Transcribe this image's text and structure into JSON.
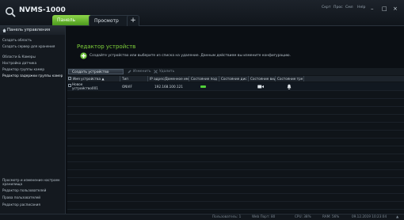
{
  "app": {
    "title": "NVMS-1000"
  },
  "tabs": [
    {
      "label": "Панель управл"
    },
    {
      "label": "Просмотр"
    },
    {
      "label": "+"
    }
  ],
  "top_menu": {
    "items": [
      "Скрт",
      "Прос",
      "Смл",
      "Help"
    ]
  },
  "window_controls": [
    "–",
    "□",
    "×"
  ],
  "sidebar": {
    "header": "Панель управления",
    "items": [
      "Создать область",
      "Создать сервер для хранения",
      "Области & Камеры",
      "Настройка датчика",
      "Редактор группы камер",
      "Редактор задержки группы камер"
    ],
    "bottom_items": [
      "Просмотр и изменение настроек хранилища",
      "Редактор пользователей",
      "Права пользователей",
      "Редактор расписания"
    ]
  },
  "main": {
    "title": "Редактор устройств",
    "info": "Создайте устройство или выберите из списка на удаление. Данным действием вы измените конфигурацию.",
    "toolbar": {
      "create": "Создать устройство",
      "edit": "Изменить",
      "delete": "Удалить"
    },
    "table": {
      "columns": [
        "Имя устройства",
        "Тип",
        "IP адрес/Доменное имя",
        "Состояние под",
        "Состояние дис",
        "Состояние вид",
        "Состояние тре"
      ],
      "rows": [
        {
          "name_line1": "Новое",
          "name_line2": "устройство001",
          "type": "ONVIF",
          "ip": "192.168.100.121"
        }
      ]
    }
  },
  "status_bar": {
    "user": "Пользователь: 1",
    "web_port": "Web Порт: 80",
    "cpu": "CPU: 38%",
    "ram": "RAM: 56%",
    "datetime": "09.12.2019 10:23:04"
  },
  "colors": {
    "accent": "#7fd13b",
    "background": "#0b0f14"
  }
}
